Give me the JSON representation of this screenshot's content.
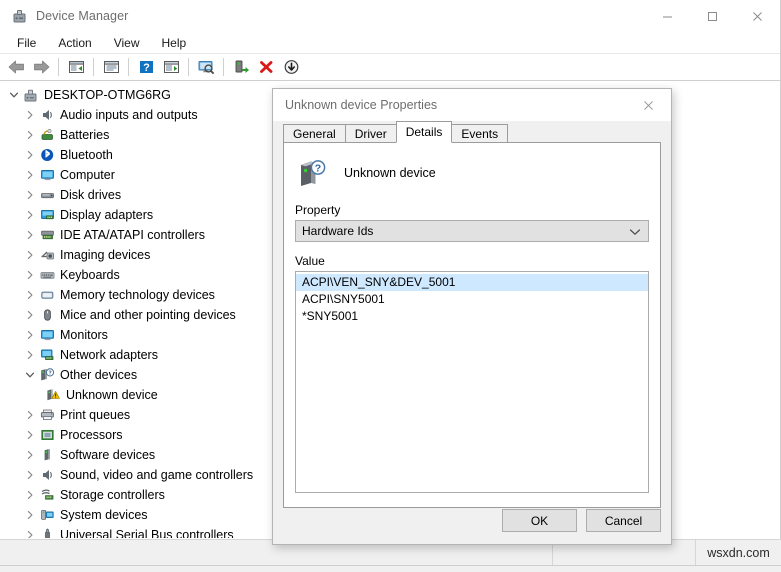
{
  "window": {
    "title": "Device Manager",
    "icon": "device-manager-icon",
    "caption_buttons": [
      {
        "name": "minimize",
        "glyph": "─"
      },
      {
        "name": "maximize",
        "glyph": "□"
      },
      {
        "name": "close",
        "glyph": "✕"
      }
    ]
  },
  "menubar": {
    "items": [
      "File",
      "Action",
      "View",
      "Help"
    ]
  },
  "toolbar": {
    "buttons": [
      {
        "name": "back-icon",
        "tip": "Back"
      },
      {
        "name": "forward-icon",
        "tip": "Forward"
      },
      {
        "name": "separator-1",
        "tip": ""
      },
      {
        "name": "show-hide-console-tree-icon",
        "tip": "Show/Hide Console Tree"
      },
      {
        "name": "separator-2",
        "tip": ""
      },
      {
        "name": "properties-icon",
        "tip": "Properties"
      },
      {
        "name": "separator-3",
        "tip": ""
      },
      {
        "name": "help-icon",
        "tip": "Help"
      },
      {
        "name": "update-driver-icon",
        "tip": "Update Driver Software"
      },
      {
        "name": "separator-4",
        "tip": ""
      },
      {
        "name": "scan-for-hardware-changes-icon",
        "tip": "Scan for hardware changes"
      },
      {
        "name": "separator-5",
        "tip": ""
      },
      {
        "name": "enable-device-icon",
        "tip": "Enable device"
      },
      {
        "name": "uninstall-device-icon",
        "tip": "Uninstall device"
      },
      {
        "name": "disable-device-icon",
        "tip": "Disable device"
      }
    ]
  },
  "tree": {
    "items": [
      {
        "label": "DESKTOP-OTMG6RG",
        "indent": 0,
        "state": "expanded",
        "icon": "computer-root-icon"
      },
      {
        "label": "Audio inputs and outputs",
        "indent": 1,
        "state": "collapsed",
        "icon": "speaker-icon"
      },
      {
        "label": "Batteries",
        "indent": 1,
        "state": "collapsed",
        "icon": "battery-icon"
      },
      {
        "label": "Bluetooth",
        "indent": 1,
        "state": "collapsed",
        "icon": "bluetooth-icon"
      },
      {
        "label": "Computer",
        "indent": 1,
        "state": "collapsed",
        "icon": "monitor-icon"
      },
      {
        "label": "Disk drives",
        "indent": 1,
        "state": "collapsed",
        "icon": "disk-drive-icon"
      },
      {
        "label": "Display adapters",
        "indent": 1,
        "state": "collapsed",
        "icon": "display-adapter-icon"
      },
      {
        "label": "IDE ATA/ATAPI controllers",
        "indent": 1,
        "state": "collapsed",
        "icon": "ide-controller-icon"
      },
      {
        "label": "Imaging devices",
        "indent": 1,
        "state": "collapsed",
        "icon": "imaging-device-icon"
      },
      {
        "label": "Keyboards",
        "indent": 1,
        "state": "collapsed",
        "icon": "keyboard-icon"
      },
      {
        "label": "Memory technology devices",
        "indent": 1,
        "state": "collapsed",
        "icon": "memory-device-icon"
      },
      {
        "label": "Mice and other pointing devices",
        "indent": 1,
        "state": "collapsed",
        "icon": "mouse-icon"
      },
      {
        "label": "Monitors",
        "indent": 1,
        "state": "collapsed",
        "icon": "monitor-icon"
      },
      {
        "label": "Network adapters",
        "indent": 1,
        "state": "collapsed",
        "icon": "network-adapter-icon"
      },
      {
        "label": "Other devices",
        "indent": 1,
        "state": "expanded",
        "icon": "other-device-icon"
      },
      {
        "label": "Unknown device",
        "indent": 2,
        "state": "leaf",
        "icon": "unknown-device-warning-icon"
      },
      {
        "label": "Print queues",
        "indent": 1,
        "state": "collapsed",
        "icon": "printer-icon"
      },
      {
        "label": "Processors",
        "indent": 1,
        "state": "collapsed",
        "icon": "processor-icon"
      },
      {
        "label": "Software devices",
        "indent": 1,
        "state": "collapsed",
        "icon": "software-device-icon"
      },
      {
        "label": "Sound, video and game controllers",
        "indent": 1,
        "state": "collapsed",
        "icon": "sound-controller-icon"
      },
      {
        "label": "Storage controllers",
        "indent": 1,
        "state": "collapsed",
        "icon": "storage-controller-icon"
      },
      {
        "label": "System devices",
        "indent": 1,
        "state": "collapsed",
        "icon": "system-device-icon"
      },
      {
        "label": "Universal Serial Bus controllers",
        "indent": 1,
        "state": "collapsed",
        "icon": "usb-controller-icon"
      }
    ]
  },
  "statusbar": {
    "cell_1": "",
    "cell_2": "",
    "watermark": "wsxdn.com"
  },
  "dialog": {
    "title": "Unknown device Properties",
    "close_glyph": "✕",
    "tabs": [
      {
        "label": "General",
        "active": false
      },
      {
        "label": "Driver",
        "active": false
      },
      {
        "label": "Details",
        "active": true
      },
      {
        "label": "Events",
        "active": false
      }
    ],
    "device_name": "Unknown device",
    "device_icon": "unknown-device-icon",
    "property_label": "Property",
    "property_selected": "Hardware Ids",
    "property_options": [
      "Hardware Ids"
    ],
    "value_label": "Value",
    "values": [
      {
        "text": "ACPI\\VEN_SNY&DEV_5001",
        "selected": true
      },
      {
        "text": "ACPI\\SNY5001",
        "selected": false
      },
      {
        "text": "*SNY5001",
        "selected": false
      }
    ],
    "buttons": [
      {
        "label": "OK",
        "name": "ok-button"
      },
      {
        "label": "Cancel",
        "name": "cancel-button"
      }
    ]
  },
  "colors": {
    "selection": "#cde8ff",
    "dialog_bg": "#f0f0f0",
    "window_bg": "#ffffff",
    "accent": "#0078d7"
  }
}
